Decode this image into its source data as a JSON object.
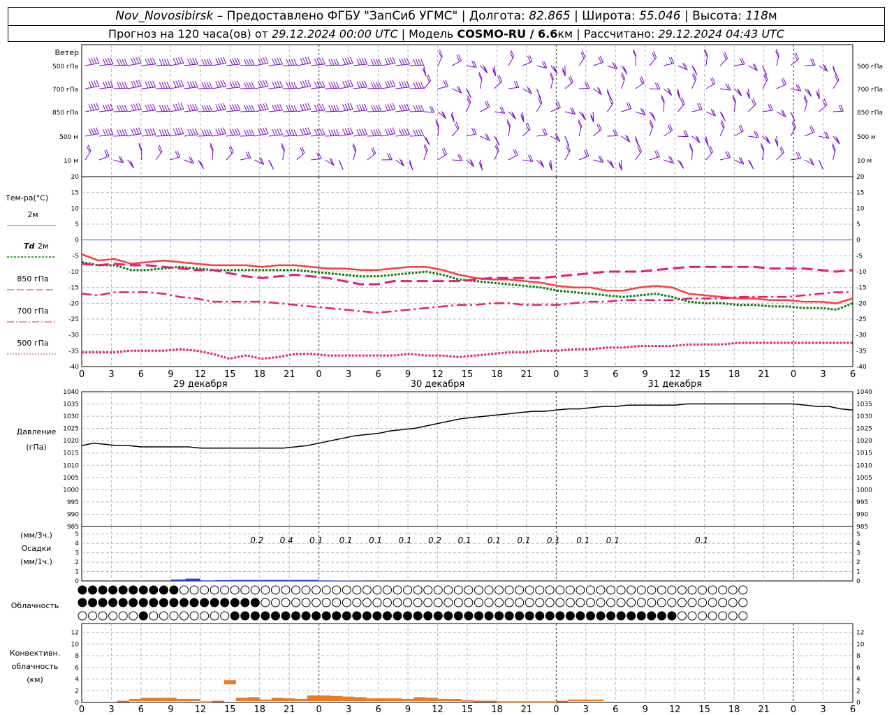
{
  "header": {
    "station": "Nov_Novosibirsk",
    "provider": "– Предоставлено ФГБУ \"ЗапСиб УГМС\"",
    "lon_label": "Долгота:",
    "lon_value": "82.865",
    "lat_label": "Широта:",
    "lat_value": "55.046",
    "alt_label": "Высота:",
    "alt_value": "118",
    "alt_unit": "м",
    "forecast_label": "Прогноз на 120 часа(ов) от",
    "forecast_start": "29.12.2024 00:00 UTC",
    "model_label": "Модель",
    "model_name": "COSMO-RU / 6.6",
    "model_unit": "км",
    "calc_label": "Рассчитано:",
    "calc_time": "29.12.2024 04:43 UTC"
  },
  "colors": {
    "t2m": "#ff3b3b",
    "td2m": "#008000",
    "t850": "#e8197a",
    "t700": "#e8197a",
    "t500": "#e8197a",
    "pressure": "#000000",
    "wind": "#7b00c8",
    "precip": "#1f3fd0",
    "convective": "#f07820",
    "zero_line": "#3a5fd0"
  },
  "wind_panel": {
    "title": "Ветер",
    "levels": [
      "500 гПа",
      "700 гПа",
      "850 гПа",
      "500 м",
      "10 м"
    ]
  },
  "temp_panel": {
    "title": "Тем-ра(°С)",
    "legend": [
      {
        "label": "2м",
        "key": "t2m",
        "style": "solid"
      },
      {
        "label_it": "Td",
        "label": "2м",
        "key": "td2m",
        "style": "dotted"
      },
      {
        "label": "850 гПа",
        "key": "t850",
        "style": "dash"
      },
      {
        "label": "700 гПа",
        "key": "t700",
        "style": "dashdot"
      },
      {
        "label": "500 гПа",
        "key": "t500",
        "style": "dot"
      }
    ],
    "ticks": [
      "20",
      "15",
      "10",
      "5",
      "0",
      "-5",
      "-10",
      "-15",
      "-20",
      "-25",
      "-30",
      "-35",
      "-40"
    ]
  },
  "time_axis": {
    "hour_labels": [
      "0",
      "3",
      "6",
      "9",
      "12",
      "15",
      "18",
      "21",
      "0",
      "3",
      "6",
      "9",
      "12",
      "15",
      "18",
      "21",
      "0",
      "3",
      "6",
      "9",
      "12",
      "15",
      "18",
      "21",
      "0",
      "3",
      "6"
    ],
    "dates": [
      "29 декабря",
      "30 декабря",
      "31 декабря"
    ]
  },
  "pressure_panel": {
    "title1": "Давление",
    "title2": "(гПа)",
    "ticks": [
      "1040",
      "1035",
      "1030",
      "1025",
      "1020",
      "1015",
      "1010",
      "1005",
      "1000",
      "995",
      "990",
      "985"
    ]
  },
  "precip_panel": {
    "title1": "(мм/3ч.)",
    "title2": "Осадки",
    "title3": "(мм/1ч.)",
    "ticks": [
      "5",
      "4",
      "3",
      "2",
      "1",
      "0"
    ],
    "labels": [
      {
        "h": 18,
        "v": "0.2"
      },
      {
        "h": 21,
        "v": "0.4"
      },
      {
        "h": 24,
        "v": "0.1"
      },
      {
        "h": 27,
        "v": "0.1"
      },
      {
        "h": 30,
        "v": "0.1"
      },
      {
        "h": 33,
        "v": "0.1"
      },
      {
        "h": 36,
        "v": "0.2"
      },
      {
        "h": 39,
        "v": "0.1"
      },
      {
        "h": 42,
        "v": "0.1"
      },
      {
        "h": 45,
        "v": "0.1"
      },
      {
        "h": 48,
        "v": "0.1"
      },
      {
        "h": 51,
        "v": "0.1"
      },
      {
        "h": 54,
        "v": "0.1"
      },
      {
        "h": 63,
        "v": "0.1"
      }
    ]
  },
  "cloud_panel": {
    "title": "Облачность"
  },
  "conv_panel": {
    "title1": "Конвективн.",
    "title2": "облачность",
    "title3": "(км)",
    "ticks": [
      "12",
      "10",
      "8",
      "6",
      "4",
      "2",
      "0"
    ]
  },
  "chart_data": {
    "type": "line",
    "x_hours_step": 3,
    "x_hours_range": [
      0,
      78
    ],
    "temperature": {
      "ylim": [
        -40,
        20
      ],
      "series": [
        {
          "name": "2м",
          "values": [
            -4.5,
            -6.5,
            -6,
            -7.5,
            -7,
            -6.5,
            -7,
            -7.5,
            -8,
            -8,
            -8,
            -8.5,
            -8,
            -8,
            -8.5,
            -9,
            -9,
            -9.5,
            -9.5,
            -9,
            -8.5,
            -8.5,
            -9.5,
            -11,
            -12,
            -12.5,
            -12.5,
            -13,
            -13.5,
            -14.5,
            -15,
            -15,
            -16,
            -16,
            -15,
            -14.5,
            -15,
            -17,
            -17.5,
            -18,
            -18.5,
            -18.5,
            -19,
            -19,
            -19.5,
            -19.5,
            -20,
            -18.5
          ]
        },
        {
          "name": "Td 2м",
          "values": [
            -7,
            -8,
            -8,
            -9.5,
            -9.5,
            -9,
            -8.5,
            -9,
            -9.5,
            -9.5,
            -9.5,
            -9.5,
            -9.5,
            -9.5,
            -10,
            -10.5,
            -11,
            -11.5,
            -11.5,
            -11,
            -10.5,
            -10,
            -11,
            -12.5,
            -13,
            -13.5,
            -14,
            -14.5,
            -15,
            -16,
            -16.5,
            -17,
            -17.5,
            -18,
            -17.5,
            -17,
            -18,
            -19.5,
            -20,
            -20,
            -20.5,
            -20.5,
            -21,
            -21,
            -21.5,
            -21.5,
            -22,
            -20
          ]
        },
        {
          "name": "850 гПа",
          "values": [
            -7.5,
            -8,
            -7.5,
            -8,
            -8,
            -8.5,
            -9,
            -9.5,
            -9.5,
            -10.5,
            -11.5,
            -12,
            -11.5,
            -11,
            -11.5,
            -12,
            -13,
            -14,
            -14,
            -13,
            -13,
            -13,
            -13,
            -13,
            -12.5,
            -12,
            -12,
            -12,
            -12,
            -11.5,
            -11,
            -10.5,
            -10,
            -10,
            -10,
            -9.5,
            -9,
            -8.5,
            -8.5,
            -8.5,
            -8.5,
            -8.5,
            -9,
            -9,
            -9,
            -9.5,
            -10,
            -9.5
          ]
        },
        {
          "name": "700 гПа",
          "values": [
            -17,
            -17.5,
            -16.5,
            -16.5,
            -16.5,
            -17,
            -18,
            -18.5,
            -19.5,
            -19.5,
            -19.5,
            -19.5,
            -20,
            -20.5,
            -21,
            -21.5,
            -22,
            -22.5,
            -23,
            -22.5,
            -22,
            -21.5,
            -21,
            -20.5,
            -20.5,
            -20,
            -20,
            -20.5,
            -20.5,
            -20.5,
            -20,
            -19.5,
            -19.5,
            -19,
            -19,
            -19,
            -19,
            -18.5,
            -18.5,
            -18.5,
            -18,
            -18,
            -18,
            -18,
            -17.5,
            -17,
            -16.5,
            -16.5
          ]
        },
        {
          "name": "500 гПа",
          "values": [
            -35.5,
            -35.5,
            -35.5,
            -35,
            -35,
            -35,
            -34.5,
            -35,
            -36,
            -37.5,
            -36.5,
            -37.5,
            -37,
            -36,
            -36,
            -36.5,
            -36.5,
            -36.5,
            -36.5,
            -36.5,
            -36,
            -36.5,
            -36.5,
            -37,
            -36.5,
            -36,
            -35.5,
            -35.5,
            -35,
            -35,
            -34.5,
            -34.5,
            -34,
            -34,
            -33.5,
            -33.5,
            -33.5,
            -33,
            -33,
            -33,
            -32.5,
            -32.5,
            -32.5,
            -32.5,
            -32.5,
            -32.5,
            -32.5,
            -32.5
          ]
        }
      ]
    },
    "pressure": {
      "ylim": [
        985,
        1040
      ],
      "values": [
        1018,
        1019,
        1018.5,
        1018,
        1018,
        1017.5,
        1017.5,
        1017.5,
        1017.5,
        1017.5,
        1017,
        1017,
        1017,
        1017,
        1017,
        1017,
        1017,
        1017,
        1017.5,
        1018,
        1019,
        1020,
        1021,
        1022,
        1022.5,
        1023,
        1024,
        1024.5,
        1025,
        1026,
        1027,
        1028,
        1029,
        1029.5,
        1030,
        1030.5,
        1031,
        1031.5,
        1032,
        1032,
        1032.5,
        1033,
        1033,
        1033.5,
        1034,
        1034,
        1034.5,
        1034.5,
        1034.5,
        1034.5,
        1034.5,
        1035,
        1035,
        1035,
        1035,
        1035,
        1035,
        1035,
        1035,
        1035,
        1035,
        1034.5,
        1034,
        1034,
        1033,
        1032.5
      ]
    },
    "precip_3h": {
      "ylim": [
        0,
        5
      ],
      "values": [
        0,
        0,
        0,
        0,
        0,
        0,
        0.15,
        0.25,
        0.05,
        0.08,
        0.1,
        0.1,
        0.1,
        0.1,
        0.1,
        0.1,
        0.05,
        0.03,
        0.02,
        0,
        0,
        0,
        0,
        0,
        0,
        0,
        0,
        0,
        0,
        0,
        0,
        0,
        0,
        0,
        0,
        0,
        0,
        0,
        0,
        0,
        0,
        0,
        0,
        0,
        0,
        0,
        0,
        0
      ]
    },
    "convective_cloud": {
      "ylim": [
        0,
        13
      ],
      "values": [
        0,
        0,
        0,
        0.3,
        0.6,
        0.8,
        0.8,
        0.8,
        0.6,
        0.6,
        0.2,
        0.3,
        3.8,
        0.8,
        0.9,
        0.5,
        0.8,
        0.7,
        0.6,
        1.2,
        1.2,
        1.1,
        1.0,
        0.9,
        0.7,
        0.7,
        0.7,
        0.6,
        0.9,
        0.8,
        0.6,
        0.6,
        0.4,
        0.3,
        0.3,
        0.2,
        0.2,
        0.2,
        0.2,
        0.2,
        0.3,
        0.5,
        0.5,
        0.5,
        0,
        0,
        0,
        0,
        0,
        0,
        0,
        0,
        0,
        0,
        0,
        0,
        0,
        0,
        0,
        0,
        0,
        0,
        0,
        0,
        0,
        0
      ]
    }
  }
}
